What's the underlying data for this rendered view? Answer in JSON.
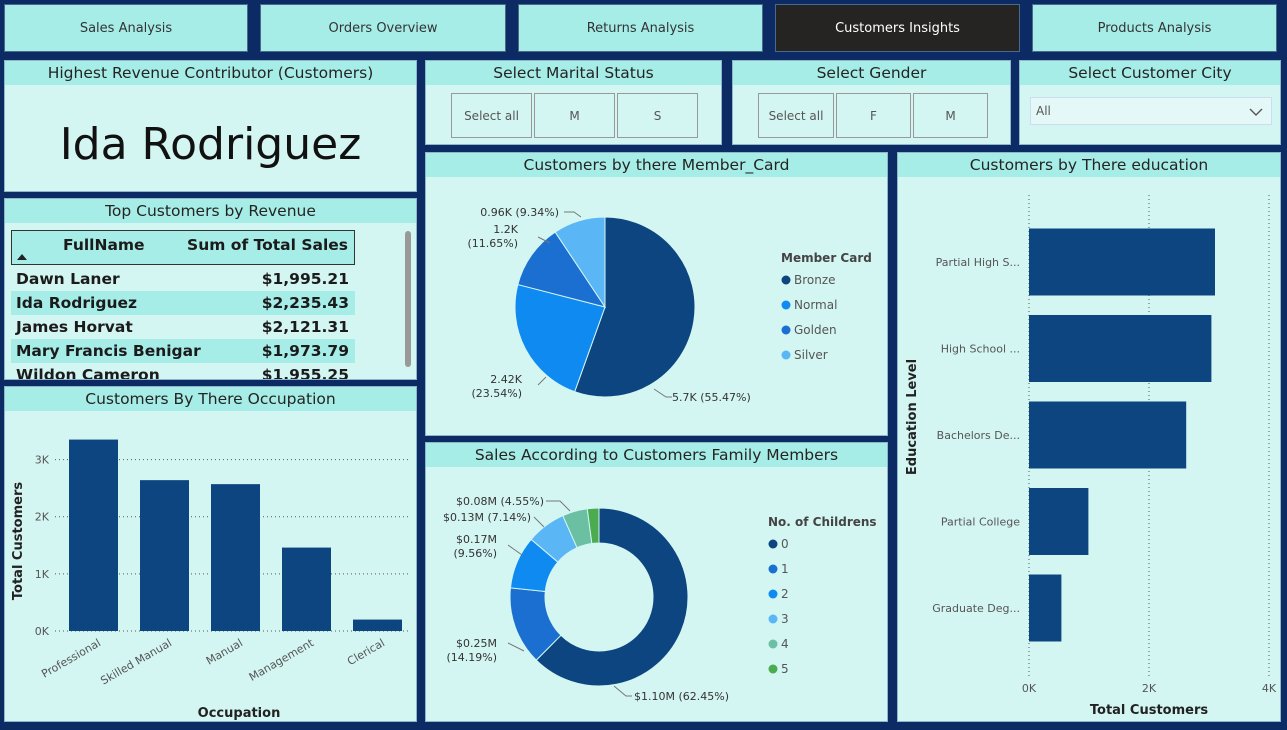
{
  "tabs": [
    {
      "label": "Sales Analysis",
      "active": false
    },
    {
      "label": "Orders Overview",
      "active": false
    },
    {
      "label": "Returns Analysis",
      "active": false
    },
    {
      "label": "Customers Insights",
      "active": true
    },
    {
      "label": "Products Analysis",
      "active": false
    }
  ],
  "top_contributor": {
    "title": "Highest Revenue Contributor (Customers)",
    "name": "Ida Rodriguez"
  },
  "top_customers": {
    "title": "Top Customers by Revenue",
    "col_name": "FullName",
    "col_sales": "Sum of Total Sales",
    "rows": [
      {
        "name": "Dawn Laner",
        "sales": "$1,995.21"
      },
      {
        "name": "Ida Rodriguez",
        "sales": "$2,235.43"
      },
      {
        "name": "James Horvat",
        "sales": "$2,121.31"
      },
      {
        "name": "Mary Francis Benigar",
        "sales": "$1,973.79"
      },
      {
        "name": "Wildon Cameron",
        "sales": "$1,955.25"
      }
    ]
  },
  "slicers": {
    "marital": {
      "title": "Select Marital Status",
      "options": [
        "Select all",
        "M",
        "S"
      ]
    },
    "gender": {
      "title": "Select Gender",
      "options": [
        "Select all",
        "F",
        "M"
      ]
    },
    "city": {
      "title": "Select Customer City",
      "value": "All"
    }
  },
  "colors": {
    "dark": "#0c4580",
    "mid": "#1a6fd1",
    "bright": "#0f8af0",
    "light": "#5ab6f5",
    "teal": "#6bbfa3",
    "green": "#4aab4f"
  },
  "chart_data": [
    {
      "type": "bar",
      "title": "Customers By There Occupation",
      "xlabel": "Occupation",
      "ylabel": "Total Customers",
      "categories": [
        "Professional",
        "Skilled Manual",
        "Manual",
        "Management",
        "Clerical"
      ],
      "values": [
        3350,
        2640,
        2570,
        1460,
        200
      ],
      "yticks": [
        "0K",
        "1K",
        "2K",
        "3K"
      ],
      "ylim": [
        0,
        3500
      ]
    },
    {
      "type": "pie",
      "title": "Customers by there Member_Card",
      "legend_title": "Member Card",
      "labels": [
        "Bronze",
        "Normal",
        "Golden",
        "Silver"
      ],
      "values": [
        55.47,
        23.54,
        11.65,
        9.34
      ],
      "data_labels": [
        "5.7K (55.47%)",
        "2.42K\n(23.54%)",
        "1.2K\n(11.65%)",
        "0.96K (9.34%)"
      ]
    },
    {
      "type": "pie",
      "title": "Sales According to Customers Family Members",
      "legend_title": "No. of Childrens",
      "labels": [
        "0",
        "1",
        "2",
        "3",
        "4",
        "5"
      ],
      "values": [
        62.45,
        14.19,
        9.56,
        7.14,
        4.55,
        2.11
      ],
      "data_labels": [
        "$1.10M (62.45%)",
        "$0.25M\n(14.19%)",
        "$0.17M\n(9.56%)",
        "$0.13M (7.14%)",
        "$0.08M (4.55%)",
        ""
      ]
    },
    {
      "type": "bar",
      "title": "Customers by There education",
      "xlabel": "Total Customers",
      "ylabel": "Education Level",
      "categories": [
        "Partial High S...",
        "High School ...",
        "Bachelors De...",
        "Partial College",
        "Graduate Deg..."
      ],
      "values": [
        3100,
        3040,
        2620,
        990,
        540
      ],
      "xticks": [
        "0K",
        "2K",
        "4K"
      ],
      "xlim": [
        0,
        4000
      ]
    }
  ]
}
